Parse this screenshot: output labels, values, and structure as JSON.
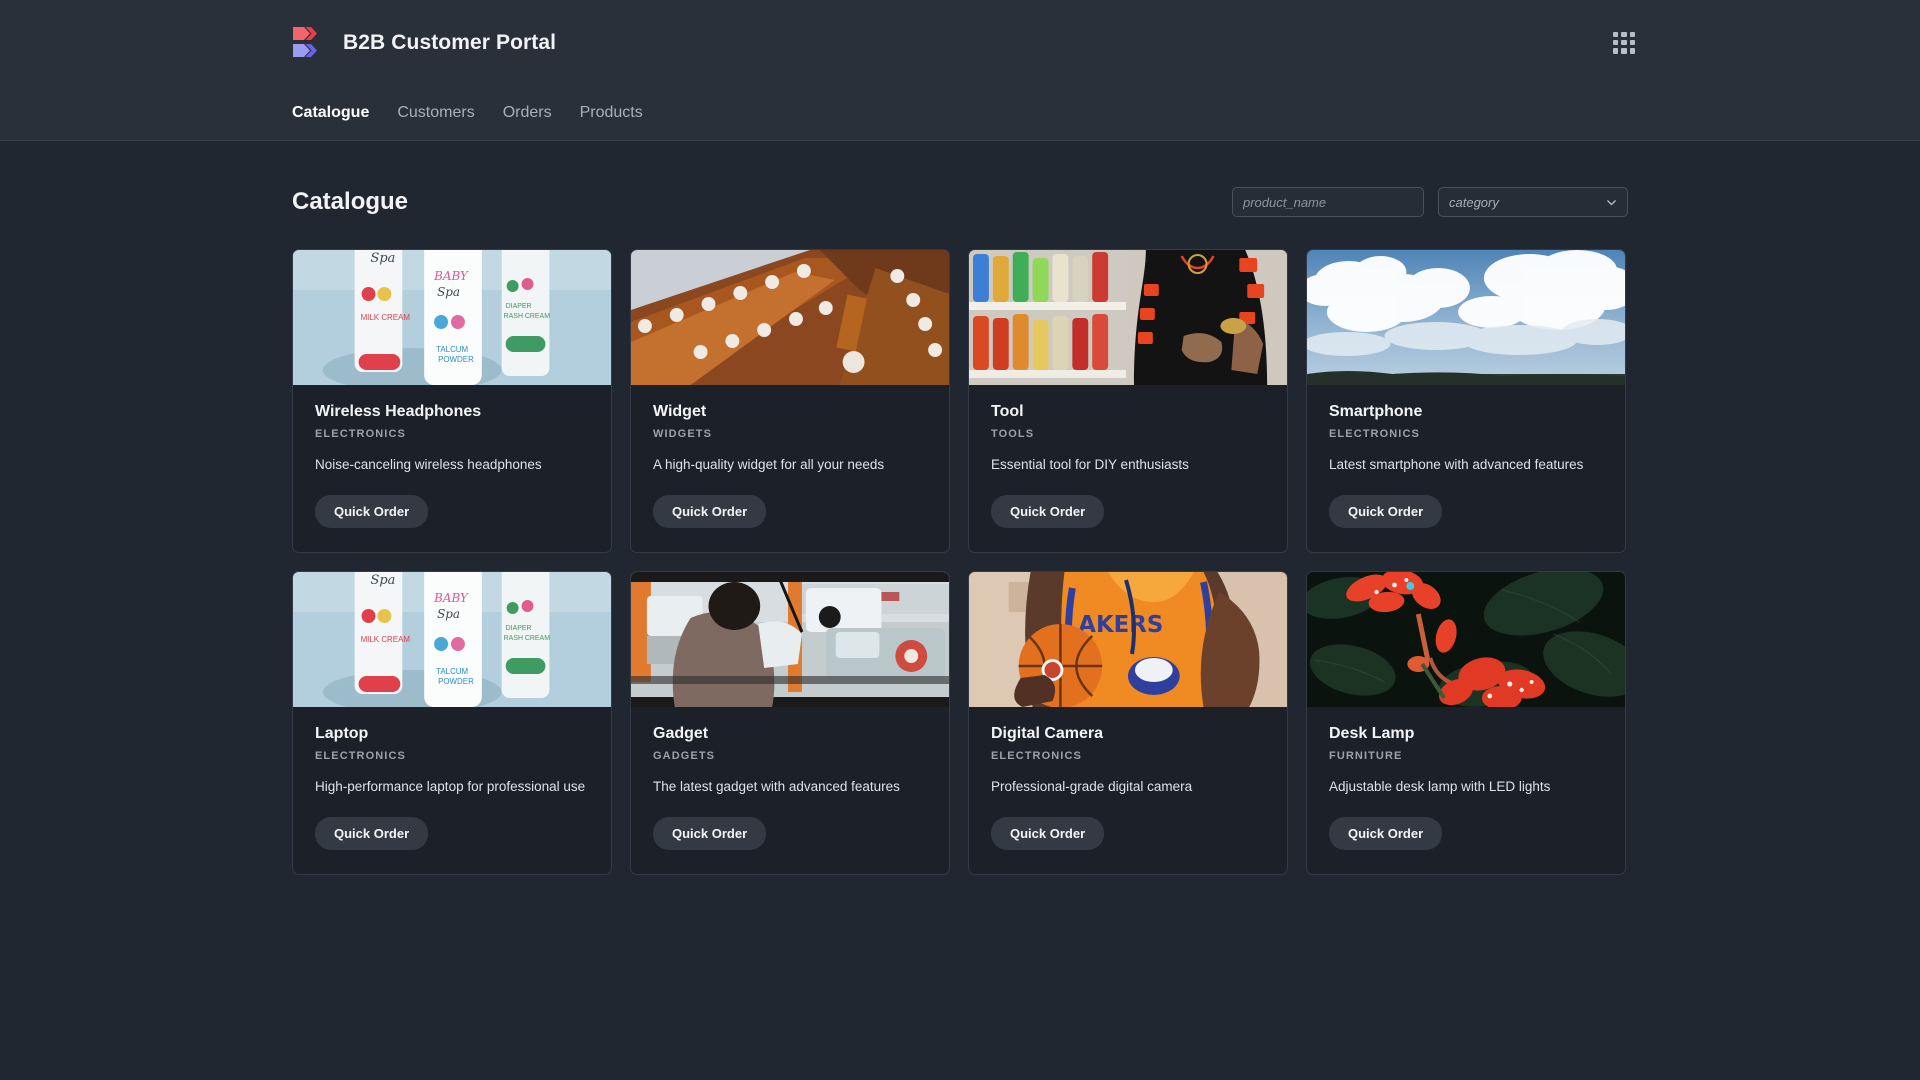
{
  "header": {
    "brand_title": "B2B Customer Portal",
    "logo_icon": "b-chevron-logo",
    "logo_colors": [
      "#f3656b",
      "#ef3b45",
      "#9b9bf0",
      "#6a63e8"
    ],
    "apps_icon": "apps-grid-icon"
  },
  "nav": {
    "items": [
      {
        "label": "Catalogue",
        "active": true
      },
      {
        "label": "Customers",
        "active": false
      },
      {
        "label": "Orders",
        "active": false
      },
      {
        "label": "Products",
        "active": false
      }
    ]
  },
  "toolbar": {
    "page_title": "Catalogue",
    "search": {
      "value": "",
      "placeholder": "product_name"
    },
    "category": {
      "selected": "category",
      "chevron_icon": "chevron-down-icon"
    }
  },
  "cards": [
    {
      "title": "Wireless Headphones",
      "category": "ELECTRONICS",
      "description": "Noise-canceling wireless headphones",
      "button": "Quick Order",
      "image": "baby-spa-tubes-on-light-blue"
    },
    {
      "title": "Widget",
      "category": "WIDGETS",
      "description": "A high-quality widget for all your needs",
      "button": "Quick Order",
      "image": "wooden-temple-roof-eaves"
    },
    {
      "title": "Tool",
      "category": "TOOLS",
      "description": "Essential tool for DIY enthusiasts",
      "button": "Quick Order",
      "image": "person-in-black-orange-hoodie-store-aisle"
    },
    {
      "title": "Smartphone",
      "category": "ELECTRONICS",
      "description": "Latest smartphone with advanced features",
      "button": "Quick Order",
      "image": "cumulus-clouds-blue-sky"
    },
    {
      "title": "Laptop",
      "category": "ELECTRONICS",
      "description": "High-performance laptop for professional use",
      "button": "Quick Order",
      "image": "baby-spa-tubes-on-light-blue"
    },
    {
      "title": "Gadget",
      "category": "GADGETS",
      "description": "The latest gadget with advanced features",
      "button": "Quick Order",
      "image": "rickshaw-interior-traffic"
    },
    {
      "title": "Digital Camera",
      "category": "ELECTRONICS",
      "description": "Professional-grade digital camera",
      "button": "Quick Order",
      "image": "basketball-player-orange-jersey"
    },
    {
      "title": "Desk Lamp",
      "category": "FURNITURE",
      "description": "Adjustable desk lamp with LED lights",
      "button": "Quick Order",
      "image": "red-flowers-dark-green-leaves"
    }
  ]
}
